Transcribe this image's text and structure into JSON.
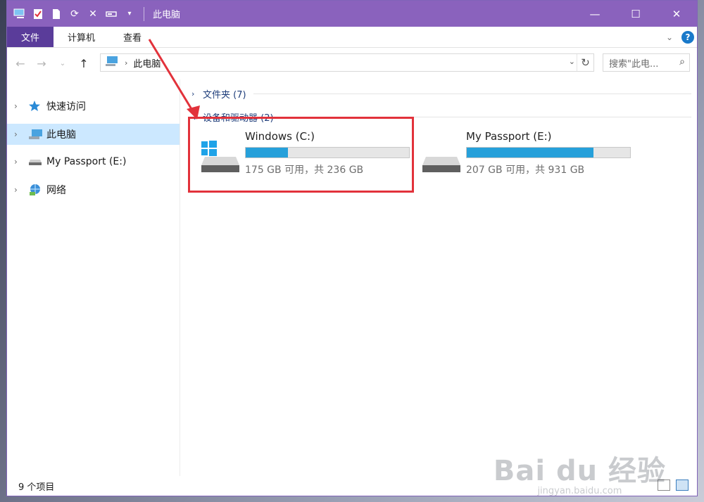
{
  "window": {
    "title": "此电脑"
  },
  "ribbon": {
    "tabs": [
      "文件",
      "计算机",
      "查看"
    ]
  },
  "address": {
    "crumb": "此电脑",
    "search_placeholder": "搜索\"此电..."
  },
  "sidebar": {
    "items": [
      {
        "label": "快速访问",
        "selected": false
      },
      {
        "label": "此电脑",
        "selected": true
      },
      {
        "label": "My Passport (E:)",
        "selected": false
      },
      {
        "label": "网络",
        "selected": false
      }
    ]
  },
  "groups": [
    {
      "label": "文件夹 (7)"
    },
    {
      "label": "设备和驱动器 (2)"
    }
  ],
  "drives": [
    {
      "name": "Windows (C:)",
      "size_text": "175 GB 可用，共 236 GB",
      "used_fraction": 0.258
    },
    {
      "name": "My Passport (E:)",
      "size_text": "207 GB 可用，共 931 GB",
      "used_fraction": 0.778
    }
  ],
  "status": {
    "item_count": "9 个项目"
  },
  "watermark": {
    "brand": "Bai du 经验",
    "url": "jingyan.baidu.com"
  },
  "colors": {
    "title_bar": "#8a62bd",
    "file_tab": "#5a3c9a",
    "drive_bar_fill": "#26a0da",
    "highlight": "#e2323b",
    "selection": "#cce8ff"
  }
}
